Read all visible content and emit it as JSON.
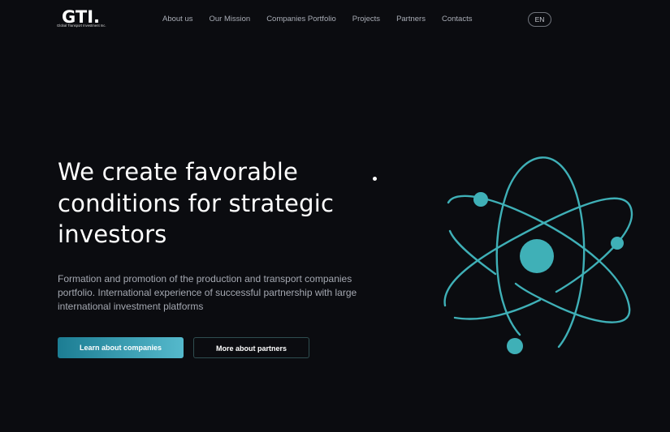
{
  "brand": {
    "logo_text": "GTI.",
    "logo_subtitle": "Global Transport Investment Inc."
  },
  "nav": {
    "items": [
      "About us",
      "Our Mission",
      "Companies Portfolio",
      "Projects",
      "Partners",
      "Contacts"
    ]
  },
  "language": "EN",
  "hero": {
    "headline_lines": [
      "We create favorable",
      "conditions for strategic",
      "investors"
    ],
    "description_lines": [
      "Formation and promotion of the production and transport companies",
      "portfolio. International experience of successful partnership with large",
      "international investment platforms"
    ],
    "primary_button": "Learn about companies",
    "secondary_button": "More about partners"
  },
  "colors": {
    "background": "#0b0c10",
    "accent": "#3fb0b7",
    "text": "#ffffff",
    "muted_text": "#a4a8b1"
  },
  "icons": {
    "hero_graphic": "atom-icon"
  }
}
